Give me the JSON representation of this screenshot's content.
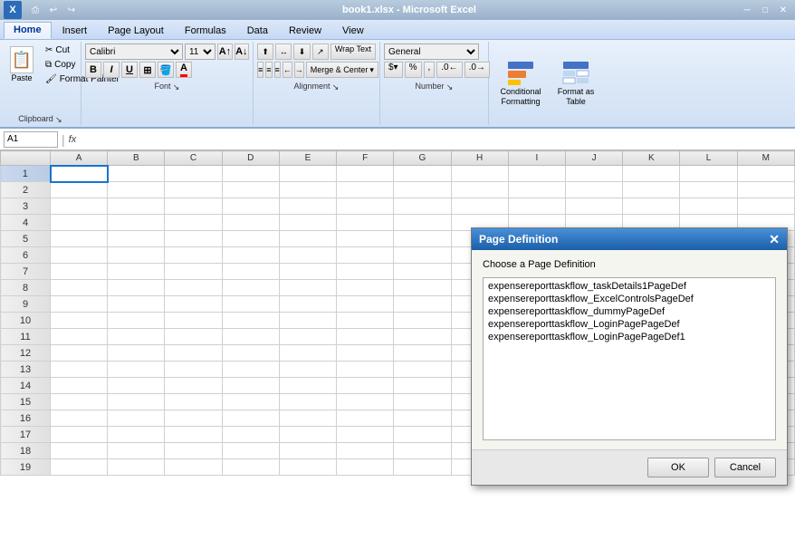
{
  "titlebar": {
    "title": "book1.xlsx - Microsoft Excel"
  },
  "quickaccess": {
    "buttons": [
      "⎙",
      "↩",
      "↪"
    ]
  },
  "ribbon": {
    "tabs": [
      "Home",
      "Insert",
      "Page Layout",
      "Formulas",
      "Data",
      "Review",
      "View"
    ],
    "active_tab": "Home",
    "clipboard": {
      "label": "Clipboard",
      "paste": "Paste",
      "cut": "Cut",
      "copy": "Copy",
      "format_painter": "Format Painter"
    },
    "font": {
      "label": "Font",
      "face": "Calibri",
      "size": "11",
      "bold": "B",
      "italic": "I",
      "underline": "U",
      "border": "⊞",
      "fill_color": "A",
      "font_color": "A"
    },
    "alignment": {
      "label": "Alignment",
      "wrap_text": "Wrap Text",
      "merge_center": "Merge & Center"
    },
    "number": {
      "label": "Number",
      "format": "General"
    },
    "styles": {
      "conditional_formatting": "Conditional Formatting",
      "format_as_table": "Format as Table"
    }
  },
  "formulabar": {
    "cell_ref": "A1",
    "fx": "fx",
    "formula": ""
  },
  "spreadsheet": {
    "columns": [
      "A",
      "B",
      "C",
      "D",
      "E",
      "F",
      "G",
      "H",
      "I",
      "J",
      "K",
      "L",
      "M"
    ],
    "rows": 19,
    "selected_cell": "A1"
  },
  "dialog": {
    "title": "Page Definition",
    "subtitle": "Choose a Page Definition",
    "items": [
      "expensereporttaskflow_taskDetails1PageDef",
      "expensereporttaskflow_ExcelControlsPageDef",
      "expensereporttaskflow_dummyPageDef",
      "expensereporttaskflow_LoginPagePageDef",
      "expensereporttaskflow_LoginPagePageDef1"
    ],
    "ok_button": "OK",
    "cancel_button": "Cancel"
  }
}
